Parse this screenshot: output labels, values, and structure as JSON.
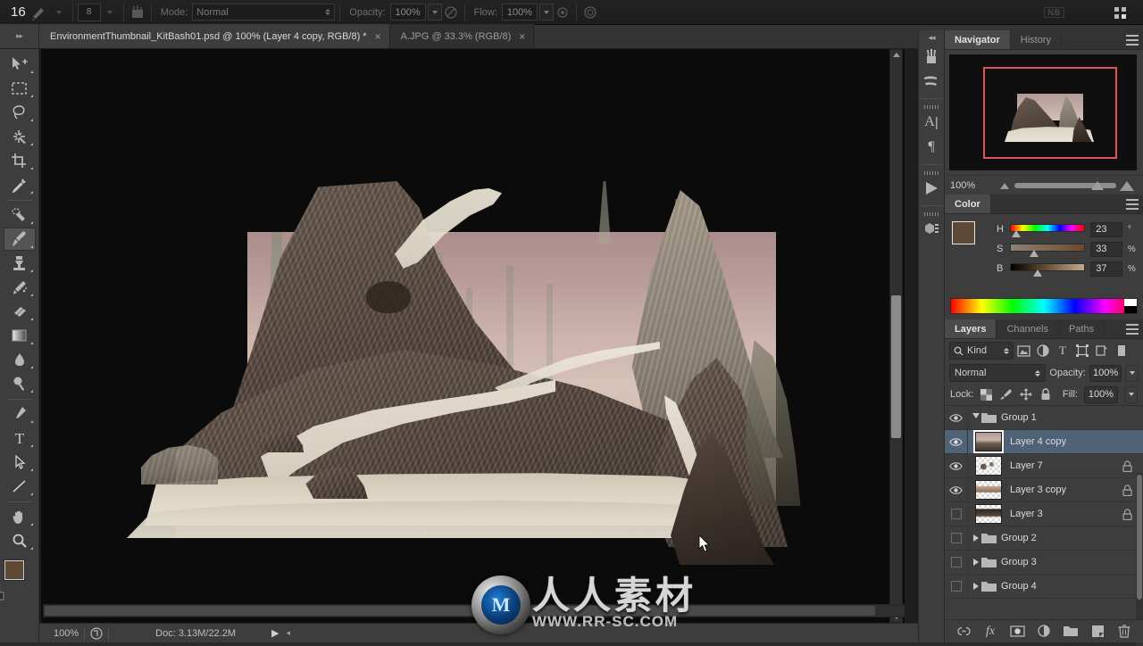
{
  "app": {
    "name": "Adobe Photoshop",
    "theme_bg": "#3d3d3d",
    "accent_selected": "#4f6276",
    "nav_view_rect_color": "#e0515a"
  },
  "options_bar": {
    "brush_size_value": "16",
    "brush_hardness_value": "8",
    "mode_label": "Mode:",
    "mode_value": "Normal",
    "opacity_label": "Opacity:",
    "opacity_value": "100%",
    "flow_label": "Flow:",
    "flow_value": "100%",
    "airbrush_icon": "airbrush-icon",
    "tablet_pressure_opacity_icon": "tablet-pressure-opacity-icon",
    "tablet_pressure_size_icon": "tablet-pressure-size-icon",
    "brush_panel_icon": "brush-panel-toggle-icon",
    "workspace_switcher_icon": "workspace-switcher-icon",
    "nb_badge": "NB"
  },
  "tab_bar": {
    "dock_grip_icon": "dock-grip-icon",
    "tabs": [
      {
        "title": "EnvironmentThumbnail_KitBash01.psd @ 100% (Layer 4 copy, RGB/8) *",
        "active": true,
        "close": "×"
      },
      {
        "title": "A.JPG @ 33.3% (RGB/8)",
        "active": false,
        "close": "×"
      }
    ]
  },
  "toolbar": {
    "tools": [
      {
        "name": "move-tool",
        "active": false,
        "has_corner": true
      },
      {
        "name": "rectangular-marquee-tool",
        "active": false,
        "has_corner": true
      },
      {
        "name": "lasso-tool",
        "active": false,
        "has_corner": true
      },
      {
        "name": "magic-wand-tool",
        "active": false,
        "has_corner": true
      },
      {
        "name": "crop-tool",
        "active": false,
        "has_corner": true
      },
      {
        "name": "eyedropper-tool",
        "active": false,
        "has_corner": true
      },
      {
        "name": "spot-healing-brush-tool",
        "active": false,
        "has_corner": true
      },
      {
        "name": "brush-tool",
        "active": true,
        "has_corner": true
      },
      {
        "name": "clone-stamp-tool",
        "active": false,
        "has_corner": true
      },
      {
        "name": "history-brush-tool",
        "active": false,
        "has_corner": true
      },
      {
        "name": "eraser-tool",
        "active": false,
        "has_corner": true
      },
      {
        "name": "gradient-tool",
        "active": false,
        "has_corner": true
      },
      {
        "name": "blur-tool",
        "active": false,
        "has_corner": true
      },
      {
        "name": "dodge-tool",
        "active": false,
        "has_corner": true
      },
      {
        "name": "pen-tool",
        "active": false,
        "has_corner": true
      },
      {
        "name": "horizontal-type-tool",
        "active": false,
        "has_corner": true
      },
      {
        "name": "path-selection-tool",
        "active": false,
        "has_corner": true
      },
      {
        "name": "line-tool",
        "active": false,
        "has_corner": true
      },
      {
        "name": "hand-tool",
        "active": false,
        "has_corner": true
      },
      {
        "name": "zoom-tool",
        "active": false,
        "has_corner": true
      }
    ],
    "foreground_color": "#5e4936",
    "background_color": "#f2f2f2",
    "swap_colors_icon": "swap-colors-icon",
    "default-colors-icon": "default-colors-icon"
  },
  "canvas": {
    "document_zoom": "100%",
    "artwork_description": "Sepia-toned matte painting of eroded rock mountains with pink haze sky",
    "cursor_icon": "arrow-cursor"
  },
  "status_bar": {
    "zoom_value": "100%",
    "doc_icon": "document-info-icon",
    "doc_info": "Doc: 3.13M/22.2M",
    "play_arrow": "▶",
    "resize_grip": "◂"
  },
  "watermark": {
    "logo_letter": "M",
    "chinese_text": "人人素材",
    "url_text": "WWW.RR-SC.COM"
  },
  "dock_strip": {
    "collapse_icon": "collapse-panels-icon",
    "icons": [
      {
        "name": "brush-presets-icon"
      },
      {
        "name": "brush-settings-icon"
      },
      {
        "name": "character-panel-icon",
        "glyph": "A"
      },
      {
        "name": "paragraph-panel-icon",
        "glyph": "¶"
      },
      {
        "name": "timeline-panel-icon"
      },
      {
        "name": "3d-panel-icon"
      }
    ]
  },
  "navigator_panel": {
    "tabs": [
      {
        "label": "Navigator",
        "active": true
      },
      {
        "label": "History",
        "active": false
      }
    ],
    "menu_icon": "panel-menu-icon",
    "zoom_value": "100%",
    "zoom_out_icon": "zoom-out-small-mountain-icon",
    "zoom_in_icon": "zoom-in-large-mountain-icon",
    "slider_name": "navigator-zoom-slider"
  },
  "color_panel": {
    "tab_label": "Color",
    "menu_icon": "panel-menu-icon",
    "foreground_color": "#5e4936",
    "background_color": "#fafafa",
    "channels": [
      {
        "label": "H",
        "value": "23",
        "unit": "°",
        "knob_pct": 8
      },
      {
        "label": "S",
        "value": "33",
        "unit": "%",
        "knob_pct": 33
      },
      {
        "label": "B",
        "value": "37",
        "unit": "%",
        "knob_pct": 37
      }
    ],
    "ramp_name": "color-spectrum-ramp"
  },
  "layers_panel": {
    "tabs": [
      {
        "label": "Layers",
        "active": true
      },
      {
        "label": "Channels",
        "active": false
      },
      {
        "label": "Paths",
        "active": false
      }
    ],
    "menu_icon": "panel-menu-icon",
    "filter": {
      "search_icon": "search-icon",
      "kind_label": "Kind",
      "filter_icons": [
        "filter-pixel-layers-icon",
        "filter-adjustment-layers-icon",
        "filter-type-layers-icon",
        "filter-shape-layers-icon",
        "filter-smart-object-icon",
        "filter-toggle-icon"
      ]
    },
    "blend_mode": "Normal",
    "opacity_label": "Opacity:",
    "opacity_value": "100%",
    "lock_label": "Lock:",
    "lock_icons": [
      "lock-transparent-pixels-icon",
      "lock-image-pixels-icon",
      "lock-position-icon",
      "lock-all-icon"
    ],
    "fill_label": "Fill:",
    "fill_value": "100%",
    "rows": [
      {
        "name": "Group 1",
        "type": "group",
        "visible": true,
        "expanded": true,
        "selected": false,
        "locked": false
      },
      {
        "name": "Layer 4 copy",
        "type": "layer",
        "visible": true,
        "expanded": false,
        "selected": true,
        "locked": false,
        "thumb": "mountain"
      },
      {
        "name": "Layer 7",
        "type": "layer",
        "visible": true,
        "expanded": false,
        "selected": false,
        "locked": true,
        "thumb": "sparse"
      },
      {
        "name": "Layer 3 copy",
        "type": "layer",
        "visible": true,
        "expanded": false,
        "selected": false,
        "locked": true,
        "thumb": "strip"
      },
      {
        "name": "Layer 3",
        "type": "layer",
        "visible": false,
        "expanded": false,
        "selected": false,
        "locked": true,
        "thumb": "dark"
      },
      {
        "name": "Group 2",
        "type": "group",
        "visible": false,
        "expanded": false,
        "selected": false,
        "locked": false
      },
      {
        "name": "Group 3",
        "type": "group",
        "visible": false,
        "expanded": false,
        "selected": false,
        "locked": false
      },
      {
        "name": "Group 4",
        "type": "group",
        "visible": false,
        "expanded": false,
        "selected": false,
        "locked": false
      }
    ],
    "footer_icons": [
      "link-layers-icon",
      "layer-styles-fx-icon",
      "add-layer-mask-icon",
      "new-adjustment-layer-icon",
      "new-group-icon",
      "new-layer-icon",
      "delete-layer-icon"
    ]
  }
}
